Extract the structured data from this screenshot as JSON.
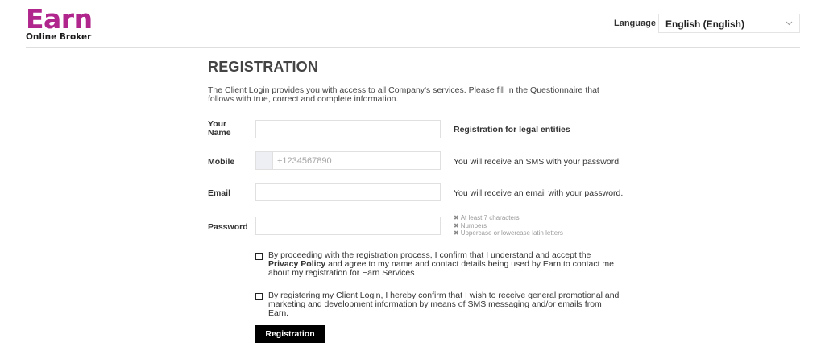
{
  "header": {
    "logo_main": "Earn",
    "logo_sub": "Online Broker",
    "language_label": "Language",
    "language_value": "English (English)"
  },
  "colors": {
    "brand": "#b0268c",
    "button_bg": "#000000"
  },
  "icons": {
    "language_dropdown": "chevron-down-icon",
    "password_rule": "cross-icon"
  },
  "registration": {
    "title": "REGISTRATION",
    "intro": "The Client Login provides you with access to all Company's services. Please fill in the Questionnaire that follows with true, correct and complete information.",
    "fields": {
      "name": {
        "label": "Your Name",
        "value": "",
        "placeholder": ""
      },
      "mobile": {
        "label": "Mobile",
        "value": "",
        "placeholder": "+1234567890"
      },
      "email": {
        "label": "Email",
        "value": "",
        "placeholder": ""
      },
      "password": {
        "label": "Password",
        "value": "",
        "placeholder": ""
      }
    },
    "legal_entities_link": "Registration for legal entities",
    "mobile_hint": "You will receive an SMS with your password.",
    "email_hint": "You will receive an email with your password.",
    "password_rules": [
      "At least 7 characters",
      "Numbers",
      "Uppercase or lowercase latin letters"
    ],
    "consent_1": {
      "before": "By proceeding with the registration process, I confirm that I understand and accept the ",
      "link": "Privacy Policy",
      "after": " and agree to my name and contact details being used by Earn to contact me about my registration for Earn Services"
    },
    "consent_2": "By registering my Client Login, I hereby confirm that I wish to receive general promotional and marketing and development information by means of SMS messaging and/or emails from Earn.",
    "submit_label": "Registration"
  }
}
